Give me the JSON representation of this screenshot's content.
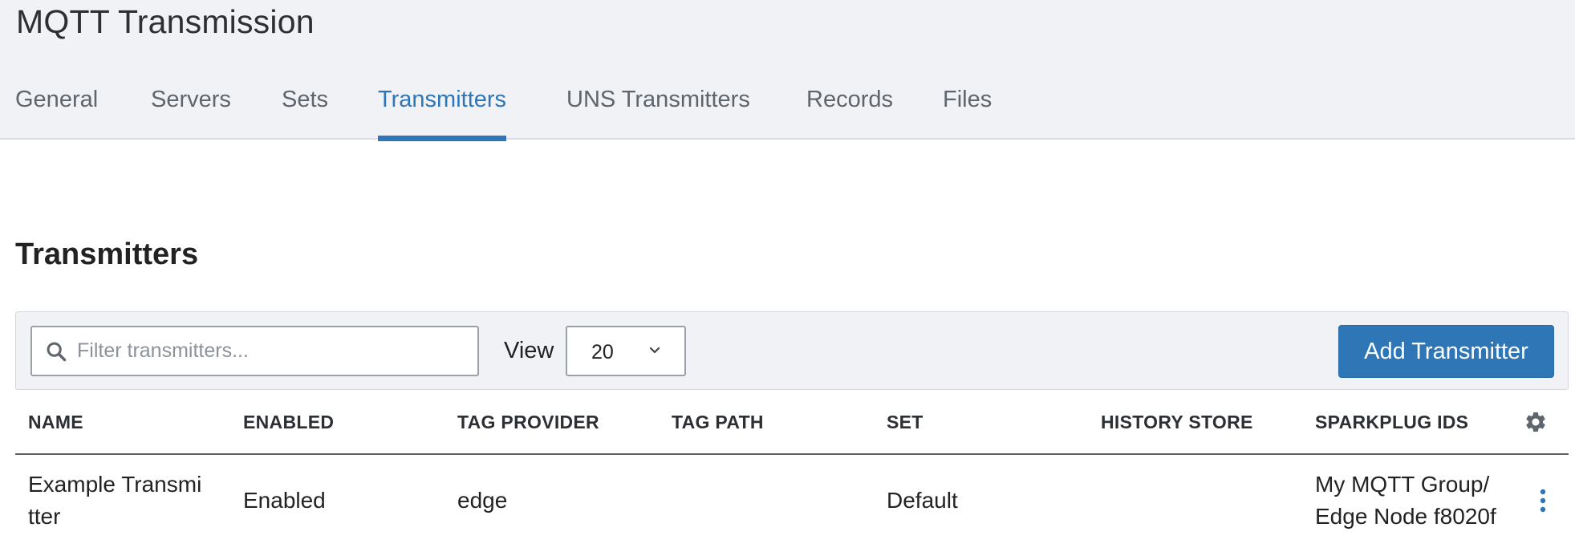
{
  "page": {
    "title": "MQTT Transmission"
  },
  "tabs": [
    {
      "label": "General",
      "active": false
    },
    {
      "label": "Servers",
      "active": false
    },
    {
      "label": "Sets",
      "active": false
    },
    {
      "label": "Transmitters",
      "active": true
    },
    {
      "label": "UNS Transmitters",
      "active": false
    },
    {
      "label": "Records",
      "active": false
    },
    {
      "label": "Files",
      "active": false
    }
  ],
  "section": {
    "title": "Transmitters"
  },
  "toolbar": {
    "search_placeholder": "Filter transmitters...",
    "search_value": "",
    "view_label": "View",
    "view_value": "20",
    "add_button_label": "Add Transmitter"
  },
  "table": {
    "columns": [
      "NAME",
      "ENABLED",
      "TAG PROVIDER",
      "TAG PATH",
      "SET",
      "HISTORY STORE",
      "SPARKPLUG IDS"
    ],
    "rows": [
      {
        "name_line1": "Example Transmi",
        "name_line2": "tter",
        "enabled": "Enabled",
        "tag_provider": "edge",
        "tag_path": "",
        "set": "Default",
        "history_store": "",
        "sparkplug_line1": "My MQTT Group/",
        "sparkplug_line2": "Edge Node f8020f"
      }
    ]
  },
  "colors": {
    "accent": "#2f76b7",
    "header_bg": "#f1f2f6"
  },
  "icons": {
    "search": "search-icon",
    "chevron": "chevron-down-icon",
    "settings": "gear-icon",
    "row_menu": "kebab-menu-icon"
  }
}
